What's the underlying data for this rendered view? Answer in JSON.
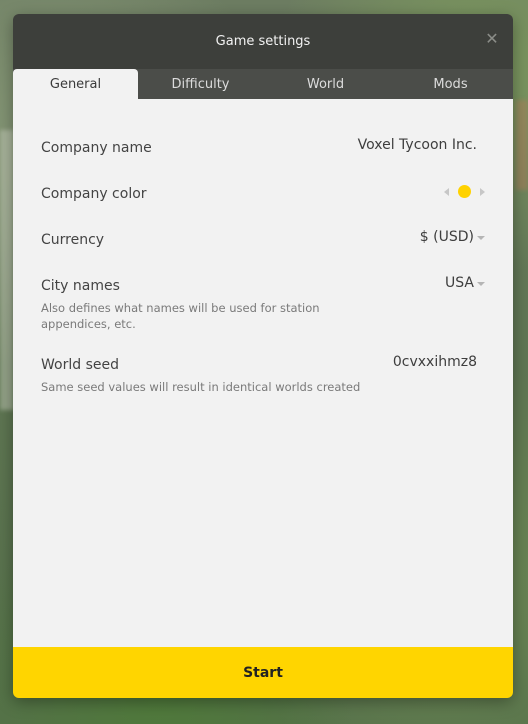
{
  "dialog": {
    "title": "Game settings",
    "close_icon": "close-icon"
  },
  "tabs": [
    {
      "label": "General",
      "active": true
    },
    {
      "label": "Difficulty",
      "active": false
    },
    {
      "label": "World",
      "active": false
    },
    {
      "label": "Mods",
      "active": false
    }
  ],
  "settings": {
    "company_name": {
      "label": "Company name",
      "value": "Voxel Tycoon Inc."
    },
    "company_color": {
      "label": "Company color",
      "color": "#ffd200",
      "prev_icon": "arrow-left-icon",
      "next_icon": "arrow-right-icon"
    },
    "currency": {
      "label": "Currency",
      "value": "$ (USD)"
    },
    "city_names": {
      "label": "City names",
      "value": "USA",
      "description": "Also defines what names will be used for station appendices, etc."
    },
    "world_seed": {
      "label": "World seed",
      "value": "0cvxxihmz8",
      "description": "Same seed values will result in identical worlds created"
    }
  },
  "actions": {
    "start_label": "Start"
  },
  "colors": {
    "accent": "#ffd500",
    "header_bg": "#3d3f3b",
    "tab_bg": "#4b4d49",
    "content_bg": "#f2f2f2"
  }
}
